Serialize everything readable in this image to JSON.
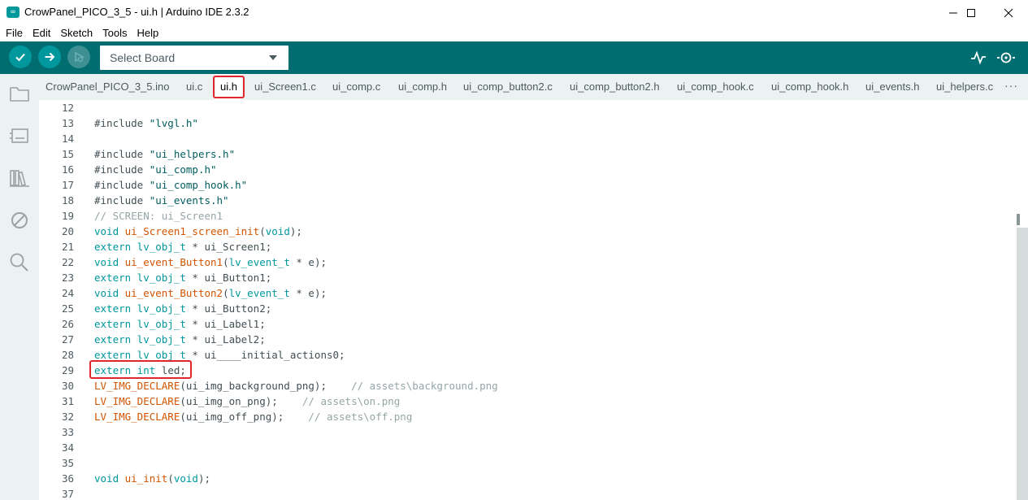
{
  "window": {
    "title": "CrowPanel_PICO_3_5 - ui.h | Arduino IDE 2.3.2",
    "app_icon": "arduino-icon",
    "controls": [
      "minimize-icon",
      "maximize-icon",
      "close-icon"
    ]
  },
  "menu": [
    "File",
    "Edit",
    "Sketch",
    "Tools",
    "Help"
  ],
  "toolbar": {
    "verify": "check-icon",
    "upload": "arrow-right-icon",
    "debug": "debug-icon",
    "board_select": "Select Board",
    "serial_plotter": "plotter-icon",
    "serial_monitor": "serial-monitor-icon"
  },
  "tabs": [
    {
      "label": "CrowPanel_PICO_3_5.ino",
      "active": false
    },
    {
      "label": "ui.c",
      "active": false
    },
    {
      "label": "ui.h",
      "active": true
    },
    {
      "label": "ui_Screen1.c",
      "active": false
    },
    {
      "label": "ui_comp.c",
      "active": false
    },
    {
      "label": "ui_comp.h",
      "active": false
    },
    {
      "label": "ui_comp_button2.c",
      "active": false
    },
    {
      "label": "ui_comp_button2.h",
      "active": false
    },
    {
      "label": "ui_comp_hook.c",
      "active": false
    },
    {
      "label": "ui_comp_hook.h",
      "active": false
    },
    {
      "label": "ui_events.h",
      "active": false
    },
    {
      "label": "ui_helpers.c",
      "active": false
    }
  ],
  "tabs_more": "···",
  "sidebar": [
    "folder-icon",
    "board-icon",
    "library-icon",
    "debug-off-icon",
    "search-icon"
  ],
  "editor": {
    "lines": [
      {
        "n": "12",
        "t": []
      },
      {
        "n": "13",
        "t": [
          [
            "tx",
            "#include "
          ],
          [
            "str",
            "\"lvgl.h\""
          ]
        ]
      },
      {
        "n": "14",
        "t": []
      },
      {
        "n": "15",
        "t": [
          [
            "tx",
            "#include "
          ],
          [
            "str",
            "\"ui_helpers.h\""
          ]
        ]
      },
      {
        "n": "16",
        "t": [
          [
            "tx",
            "#include "
          ],
          [
            "str",
            "\"ui_comp.h\""
          ]
        ]
      },
      {
        "n": "17",
        "t": [
          [
            "tx",
            "#include "
          ],
          [
            "str",
            "\"ui_comp_hook.h\""
          ]
        ]
      },
      {
        "n": "18",
        "t": [
          [
            "tx",
            "#include "
          ],
          [
            "str",
            "\"ui_events.h\""
          ]
        ]
      },
      {
        "n": "19",
        "t": [
          [
            "cm",
            "// SCREEN: ui_Screen1"
          ]
        ]
      },
      {
        "n": "20",
        "t": [
          [
            "kw",
            "void "
          ],
          [
            "fn",
            "ui_Screen1_screen_init"
          ],
          [
            "tx",
            "("
          ],
          [
            "kw",
            "void"
          ],
          [
            "tx",
            ");"
          ]
        ]
      },
      {
        "n": "21",
        "t": [
          [
            "kw",
            "extern lv_obj_t"
          ],
          [
            "tx",
            " * ui_Screen1;"
          ]
        ]
      },
      {
        "n": "22",
        "t": [
          [
            "kw",
            "void "
          ],
          [
            "fn",
            "ui_event_Button1"
          ],
          [
            "tx",
            "("
          ],
          [
            "kw",
            "lv_event_t"
          ],
          [
            "tx",
            " * e);"
          ]
        ]
      },
      {
        "n": "23",
        "t": [
          [
            "kw",
            "extern lv_obj_t"
          ],
          [
            "tx",
            " * ui_Button1;"
          ]
        ]
      },
      {
        "n": "24",
        "t": [
          [
            "kw",
            "void "
          ],
          [
            "fn",
            "ui_event_Button2"
          ],
          [
            "tx",
            "("
          ],
          [
            "kw",
            "lv_event_t"
          ],
          [
            "tx",
            " * e);"
          ]
        ]
      },
      {
        "n": "25",
        "t": [
          [
            "kw",
            "extern lv_obj_t"
          ],
          [
            "tx",
            " * ui_Button2;"
          ]
        ]
      },
      {
        "n": "26",
        "t": [
          [
            "kw",
            "extern lv_obj_t"
          ],
          [
            "tx",
            " * ui_Label1;"
          ]
        ]
      },
      {
        "n": "27",
        "t": [
          [
            "kw",
            "extern lv_obj_t"
          ],
          [
            "tx",
            " * ui_Label2;"
          ]
        ]
      },
      {
        "n": "28",
        "t": [
          [
            "kw",
            "extern lv_obj_t"
          ],
          [
            "tx",
            " * ui____initial_actions0;"
          ]
        ]
      },
      {
        "n": "29",
        "t": [
          [
            "kw",
            "extern int"
          ],
          [
            "tx",
            " led;"
          ]
        ]
      },
      {
        "n": "30",
        "t": [
          [
            "fn",
            "LV_IMG_DECLARE"
          ],
          [
            "tx",
            "(ui_img_background_png);    "
          ],
          [
            "cm",
            "// assets\\background.png"
          ]
        ]
      },
      {
        "n": "31",
        "t": [
          [
            "fn",
            "LV_IMG_DECLARE"
          ],
          [
            "tx",
            "(ui_img_on_png);    "
          ],
          [
            "cm",
            "// assets\\on.png"
          ]
        ]
      },
      {
        "n": "32",
        "t": [
          [
            "fn",
            "LV_IMG_DECLARE"
          ],
          [
            "tx",
            "(ui_img_off_png);    "
          ],
          [
            "cm",
            "// assets\\off.png"
          ]
        ]
      },
      {
        "n": "33",
        "t": []
      },
      {
        "n": "34",
        "t": []
      },
      {
        "n": "35",
        "t": []
      },
      {
        "n": "36",
        "t": [
          [
            "kw",
            "void "
          ],
          [
            "fn",
            "ui_init"
          ],
          [
            "tx",
            "("
          ],
          [
            "kw",
            "void"
          ],
          [
            "tx",
            ");"
          ]
        ]
      },
      {
        "n": "37",
        "t": []
      }
    ]
  },
  "colors": {
    "toolbar": "#006d70",
    "button": "#00979d",
    "highlight": "#e0262e"
  }
}
